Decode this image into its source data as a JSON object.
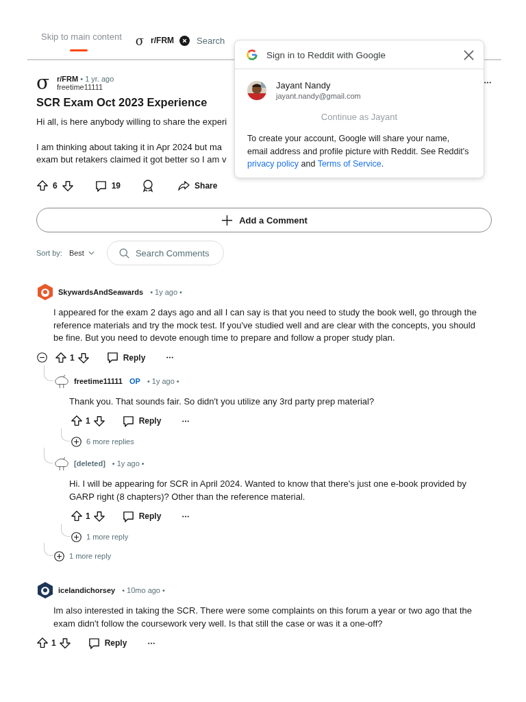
{
  "header": {
    "skip_link": "Skip to main content",
    "icon": "σ",
    "subreddit": "r/FRM",
    "search_placeholder": "Search"
  },
  "post": {
    "icon": "σ",
    "subreddit": "r/FRM",
    "age": "• 1 yr. ago",
    "author": "freetime11111",
    "title": "SCR Exam Oct 2023 Experience",
    "paragraphs": [
      [
        "Hi all, is here anybody willing to share the experi"
      ],
      [
        "I am thinking about taking it in Apr 2024 but ma",
        "exam but retakers claimed it got better so I am v"
      ]
    ],
    "votes": "6",
    "comments": "19",
    "share": "Share"
  },
  "add_comment": "Add a Comment",
  "sort": {
    "label": "Sort by:",
    "value": "Best"
  },
  "search_comments": {
    "placeholder": "Search Comments"
  },
  "comments": [
    {
      "author": "SkywardsAndSeawards",
      "age": "• 1y ago •",
      "text": "I appeared for the exam 2 days ago and all I can say is that you need to study the book well, go through the reference materials and try the mock test. If you've studied well and are clear with the concepts, you should be fine. But you need to devote enough time to prepare and follow a proper study plan.",
      "votes": "1",
      "reply": "Reply",
      "more_replies": "1 more reply",
      "children": [
        {
          "author": "freetime11111",
          "avatar": {
            "kind": "outline"
          },
          "badge": "OP",
          "age": "• 1y ago •",
          "text": "Thank you. That sounds fair. So didn't you utilize any 3rd party prep material?",
          "votes": "1",
          "reply": "Reply",
          "more_replies": "6 more replies"
        },
        {
          "author": "[deleted]",
          "avatar": {
            "kind": "outline"
          },
          "age": "• 1y ago •",
          "text": "Hi. I will be appearing for SCR in April 2024. Wanted to know that there's just one e-book provided by GARP right (8 chapters)? Other than the reference material.",
          "votes": "1",
          "reply": "Reply",
          "more_replies": "1 more reply"
        }
      ]
    },
    {
      "author": "icelandichorsey",
      "age": "• 10mo ago •",
      "text": "Im also interested in taking the SCR. There were some complaints on this forum a year or two ago that the exam didn't follow the coursework very well. Is that still the case or was it a one-off?",
      "votes": "1",
      "reply": "Reply"
    }
  ],
  "google_popup": {
    "title": "Sign in to Reddit with Google",
    "account_name": "Jayant Nandy",
    "account_email": "jayant.nandy@gmail.com",
    "continue_button": "Continue as Jayant",
    "notice": "To create your account, Google will share your name, email address and profile picture with Reddit. See Reddit's",
    "privacy_link": "privacy policy",
    "and": "and",
    "terms_link": "Terms of Service",
    "end": "."
  }
}
